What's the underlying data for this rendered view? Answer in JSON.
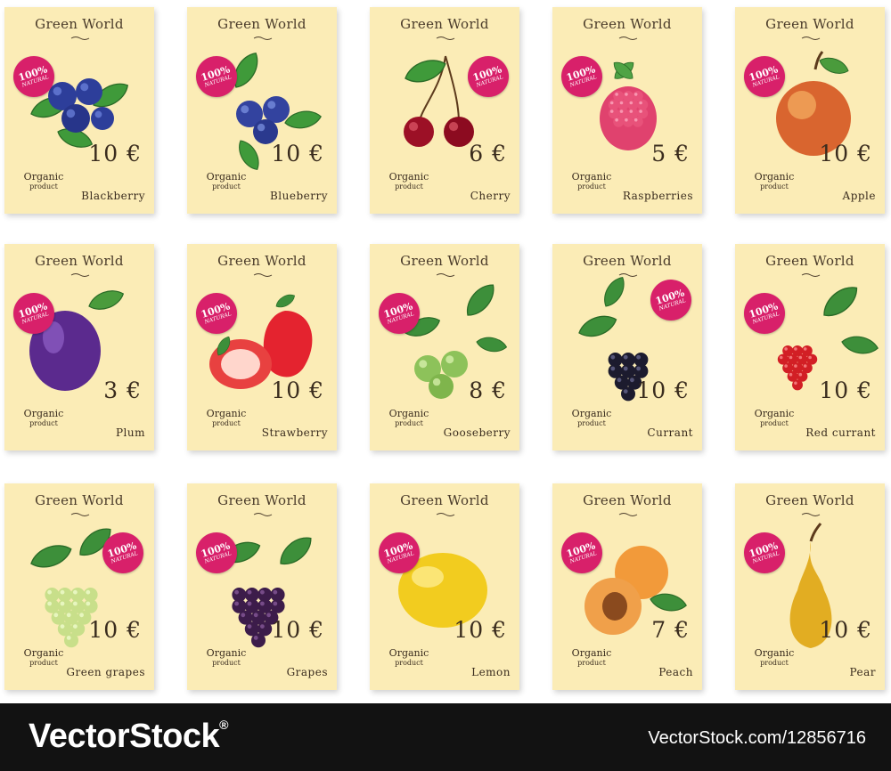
{
  "brand": "Green World",
  "badge": {
    "percent": "100%",
    "natural": "NATURAL"
  },
  "organic": {
    "line1": "Organic",
    "line2": "product"
  },
  "cards": [
    {
      "name": "Blackberry",
      "price": "10 €",
      "fruit": "blackberry-icon"
    },
    {
      "name": "Blueberry",
      "price": "10 €",
      "fruit": "blueberry-icon"
    },
    {
      "name": "Cherry",
      "price": "6 €",
      "fruit": "cherry-icon"
    },
    {
      "name": "Raspberries",
      "price": "5 €",
      "fruit": "raspberry-icon"
    },
    {
      "name": "Apple",
      "price": "10 €",
      "fruit": "apple-icon"
    },
    {
      "name": "Plum",
      "price": "3 €",
      "fruit": "plum-icon"
    },
    {
      "name": "Strawberry",
      "price": "10 €",
      "fruit": "strawberry-icon"
    },
    {
      "name": "Gooseberry",
      "price": "8 €",
      "fruit": "gooseberry-icon"
    },
    {
      "name": "Currant",
      "price": "10 €",
      "fruit": "currant-icon"
    },
    {
      "name": "Red currant",
      "price": "10 €",
      "fruit": "red-currant-icon"
    },
    {
      "name": "Green grapes",
      "price": "10 €",
      "fruit": "green-grapes-icon"
    },
    {
      "name": "Grapes",
      "price": "10 €",
      "fruit": "grapes-icon"
    },
    {
      "name": "Lemon",
      "price": "10 €",
      "fruit": "lemon-icon"
    },
    {
      "name": "Peach",
      "price": "7 €",
      "fruit": "peach-icon"
    },
    {
      "name": "Pear",
      "price": "10 €",
      "fruit": "pear-icon"
    }
  ],
  "footer": {
    "brand": "VectorStock",
    "registered": "®",
    "url": "VectorStock.com/12856716"
  },
  "colors": {
    "card": "#fbecb6",
    "badge": "#d8206a",
    "text": "#3a2c1e",
    "footer": "#121212"
  }
}
